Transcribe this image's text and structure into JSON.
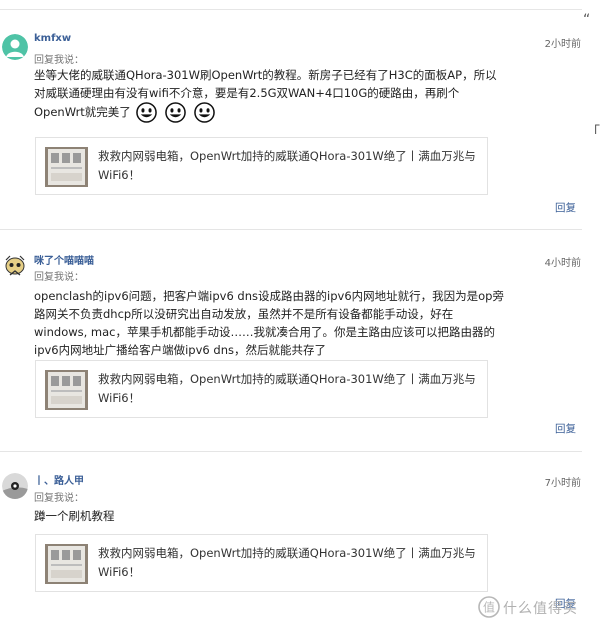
{
  "comments": [
    {
      "username": "kmfxw",
      "reply_hint": "回复我说：",
      "time": "2小时前",
      "text": "坐等大佬的威联通QHora-301W刷OpenWrt的教程。新房子已经有了H3C的面板AP，所以对威联通硬理由有没有wifi不介意，要是有2.5G双WAN+4口10G的硬路由，再刷个OpenWrt就完美了",
      "emoji_count": 3,
      "card_title": "救救内网弱电箱，OpenWrt加持的威联通QHora-301W绝了丨满血万兆与WiFi6！",
      "reply_label": "回复"
    },
    {
      "username": "咪了个喵喵喵",
      "reply_hint": "回复我说：",
      "time": "4小时前",
      "text": "openclash的ipv6问题，把客户端ipv6 dns设成路由器的ipv6内网地址就行，我因为是op旁路网关不负责dhcp所以没研究出自动发放，虽然并不是所有设备都能手动设，好在windows, mac，苹果手机都能手动设……我就凑合用了。你是主路由应该可以把路由器的ipv6内网地址广播给客户端做ipv6 dns，然后就能共存了",
      "card_title": "救救内网弱电箱，OpenWrt加持的威联通QHora-301W绝了丨满血万兆与WiFi6！",
      "reply_label": "回复"
    },
    {
      "username": "丨、路人甲",
      "reply_hint": "回复我说：",
      "time": "7小时前",
      "text": "蹲一个刷机教程",
      "card_title": "救救内网弱电箱，OpenWrt加持的威联通QHora-301W绝了丨满血万兆与WiFi6！",
      "reply_label": "回复"
    }
  ],
  "right_edge_glyphs": [
    "“",
    "「"
  ],
  "watermark": {
    "icon": "zdm-logo-icon",
    "text": "什么值得买"
  },
  "colors": {
    "link": "#3b5f97",
    "separator": "#e5e5e5",
    "avatar_teal": "#4fc3a6"
  }
}
